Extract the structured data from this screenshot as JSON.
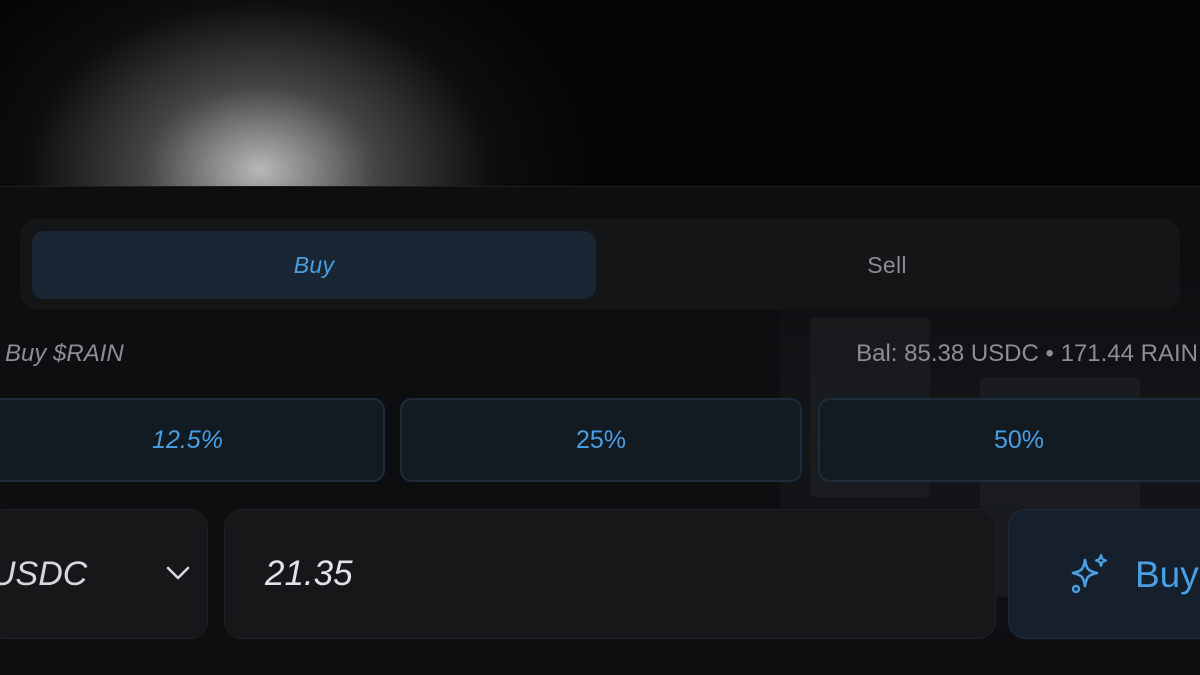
{
  "tabs": {
    "buy_label": "Buy",
    "sell_label": "Sell",
    "active": "buy"
  },
  "info": {
    "title": "Buy $RAIN",
    "balance": "Bal: 85.38 USDC • 171.44 RAIN"
  },
  "percent_buttons": [
    {
      "label": "12.5%"
    },
    {
      "label": "25%"
    },
    {
      "label": "50%"
    }
  ],
  "token_select": {
    "value": "USDC",
    "icon": "chevron-down-icon"
  },
  "amount": {
    "value": "21.35"
  },
  "action": {
    "label": "Buy",
    "icon": "sparkle-icon"
  },
  "colors": {
    "accent": "#4a9fe4",
    "panel": "#0d0e10",
    "active_tab": "#1a2633"
  }
}
